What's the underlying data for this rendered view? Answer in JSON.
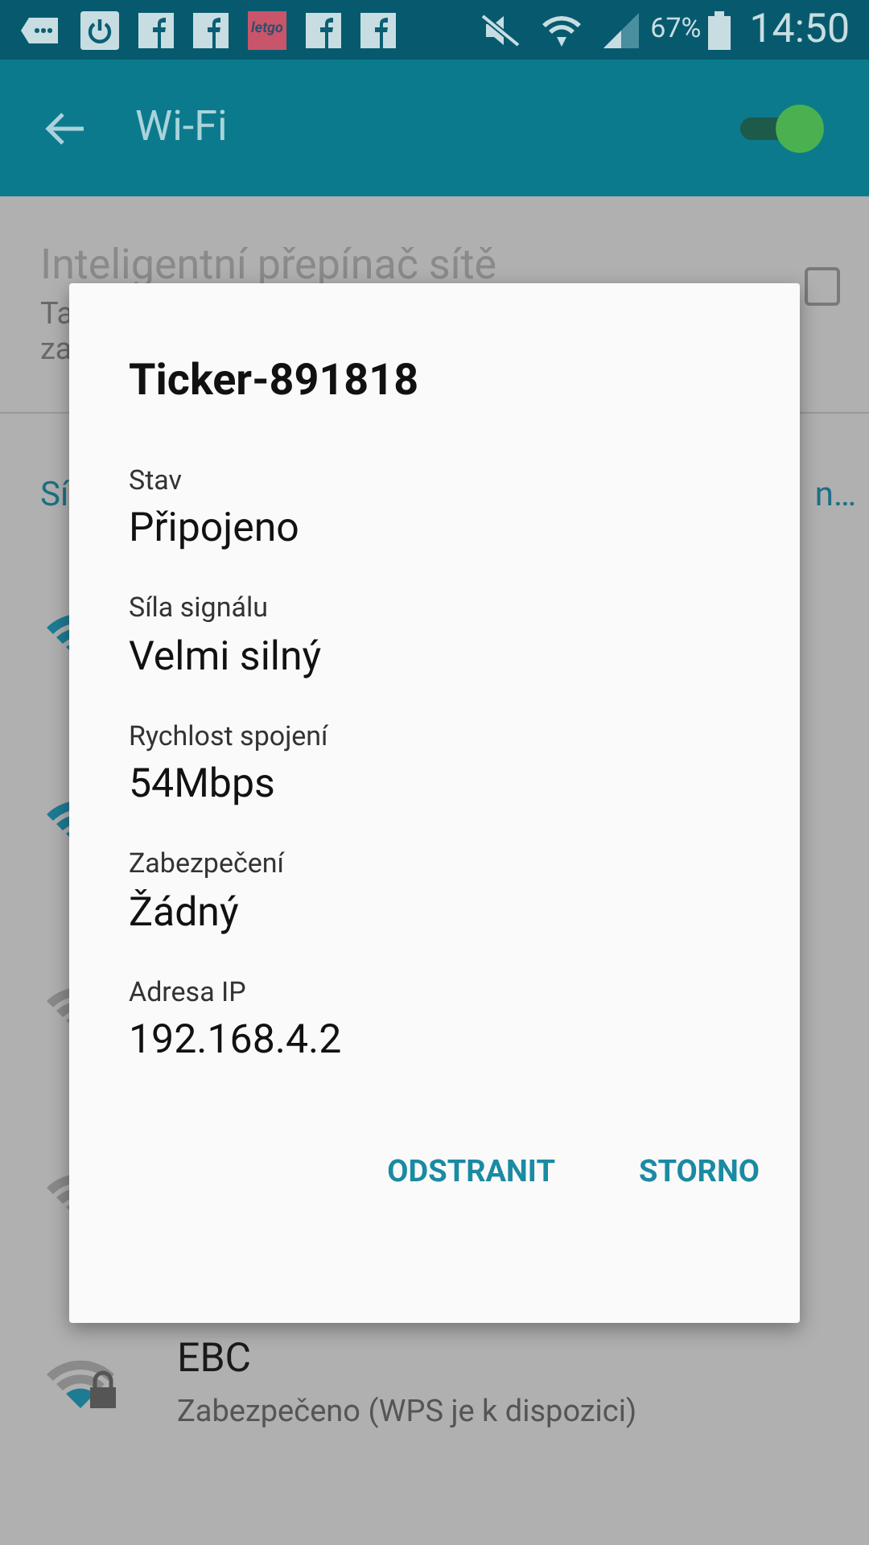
{
  "status_bar": {
    "notifications": [
      {
        "kind": "chat"
      },
      {
        "kind": "power"
      },
      {
        "kind": "facebook"
      },
      {
        "kind": "facebook"
      },
      {
        "kind": "app",
        "label": "letgo"
      },
      {
        "kind": "facebook"
      },
      {
        "kind": "facebook"
      }
    ],
    "battery": "67%",
    "time": "14:50"
  },
  "app_bar": {
    "title": "Wi-Fi",
    "wifi_on": true
  },
  "background": {
    "smart_switch_title": "Inteligentní přepínač sítě",
    "smart_switch_fragments": [
      "Ta",
      "za"
    ],
    "smart_switch_checked": false,
    "section_fragment_left": "Sí",
    "section_fragment_right": "n…",
    "networks": [
      {
        "kind": "connected"
      },
      {
        "kind": "connected"
      },
      {
        "kind": "other"
      },
      {
        "kind": "other"
      },
      {
        "kind": "locked",
        "name": "EBC",
        "status": "Zabezpečeno (WPS je k dispozici)"
      }
    ]
  },
  "dialog": {
    "title": "Ticker-891818",
    "fields": [
      {
        "label": "Stav",
        "value": "Připojeno"
      },
      {
        "label": "Síla signálu",
        "value": "Velmi silný"
      },
      {
        "label": "Rychlost spojení",
        "value": "54Mbps"
      },
      {
        "label": "Zabezpečení",
        "value": "Žádný"
      },
      {
        "label": "Adresa IP",
        "value": "192.168.4.2"
      }
    ],
    "buttons": [
      "ODSTRANIT",
      "STORNO"
    ]
  }
}
